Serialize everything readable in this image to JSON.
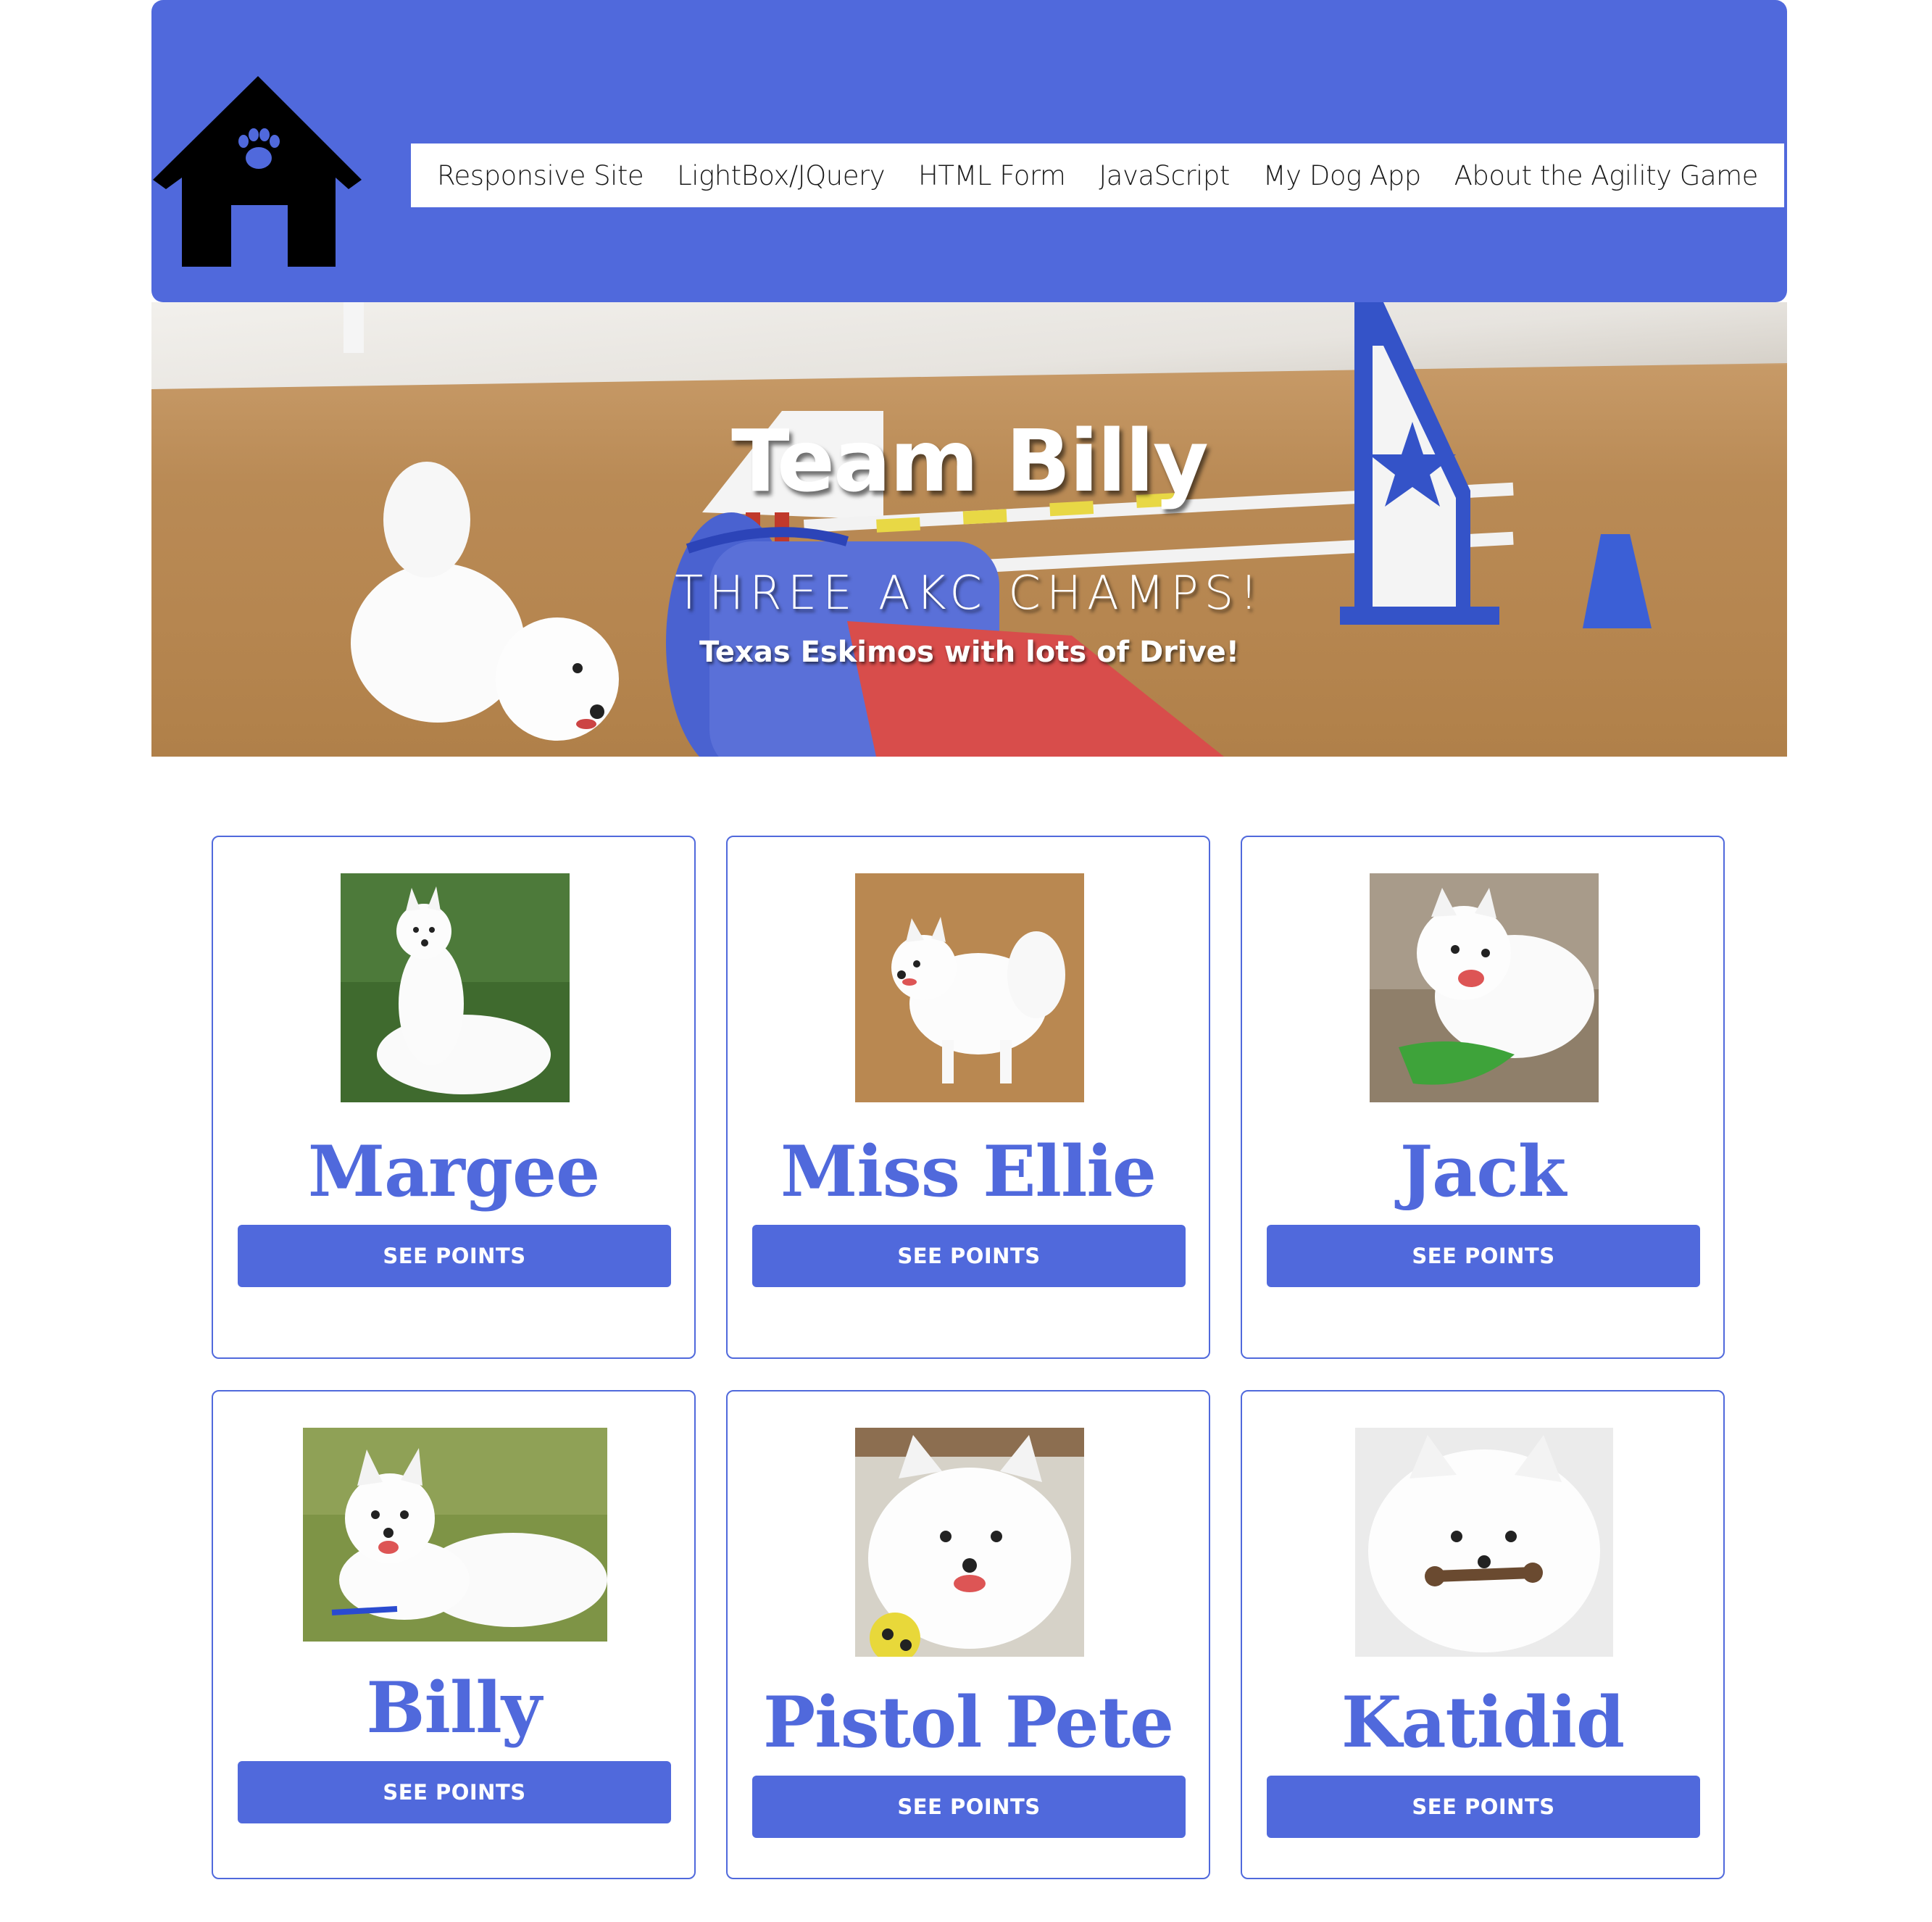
{
  "nav": {
    "items": [
      {
        "label": "Responsive Site"
      },
      {
        "label": "LightBox/JQuery"
      },
      {
        "label": "HTML Form"
      },
      {
        "label": "JavaScript"
      },
      {
        "label": "My Dog App"
      },
      {
        "label": "About the Agility Game"
      }
    ]
  },
  "hero": {
    "title": "Team Billy",
    "subtitle": "THREE AKC CHAMPS!",
    "tagline": "Texas Eskimos with lots of Drive!"
  },
  "dogs": [
    {
      "name": "Margee",
      "button": "SEE POINTS"
    },
    {
      "name": "Miss Ellie",
      "button": "SEE POINTS"
    },
    {
      "name": "Jack",
      "button": "SEE POINTS"
    },
    {
      "name": "Billy",
      "button": "SEE POINTS"
    },
    {
      "name": "Pistol Pete",
      "button": "SEE POINTS"
    },
    {
      "name": "Katidid",
      "button": "SEE POINTS"
    }
  ],
  "colors": {
    "brand": "#5069dc",
    "nav_bg": "#ffffff",
    "page_bg": "#ffffff"
  },
  "icons": {
    "logo": "doghouse-paw-icon"
  }
}
